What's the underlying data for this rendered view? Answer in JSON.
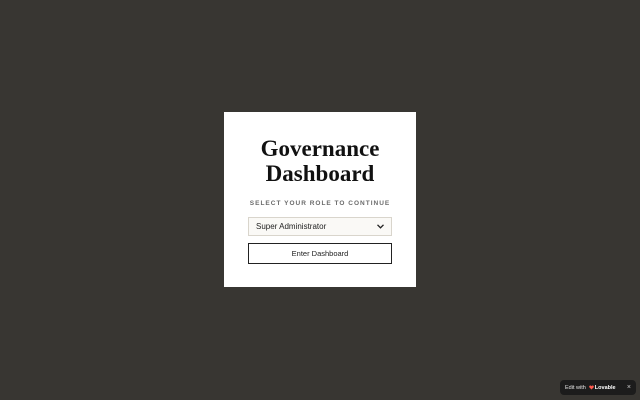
{
  "login": {
    "title_line1": "Governance",
    "title_line2": "Dashboard",
    "subtitle": "SELECT YOUR ROLE TO CONTINUE",
    "role_select": {
      "selected": "Super Administrator"
    },
    "enter_label": "Enter Dashboard"
  },
  "badge": {
    "edit_label": "Edit with",
    "brand_label": "Lovable",
    "close_label": "×"
  },
  "colors": {
    "background": "#383632",
    "card": "#ffffff",
    "brand_heart": "#ff5a4e"
  },
  "icons": {
    "select_chevron": "chevron-down-icon",
    "brand_mark": "heart-icon",
    "close": "close-icon"
  }
}
